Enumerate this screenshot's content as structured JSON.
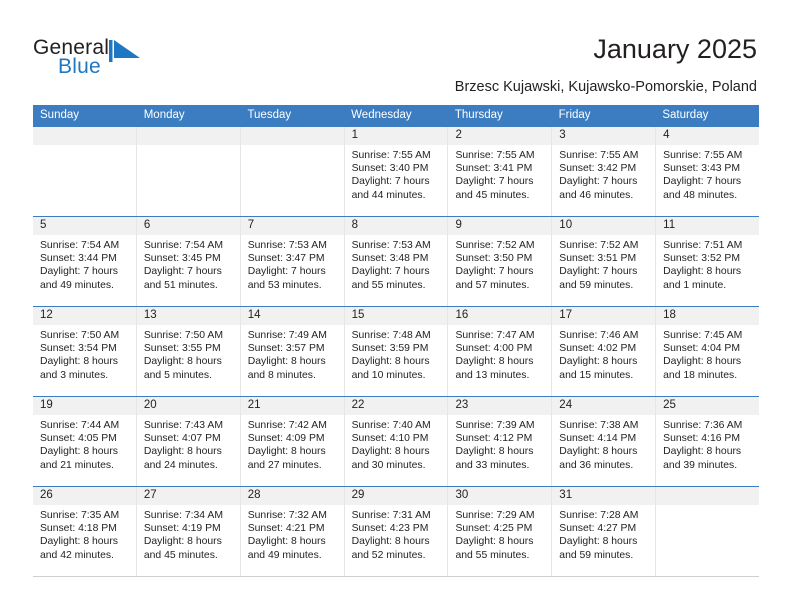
{
  "brand": {
    "name_part1": "General",
    "name_part2": "Blue",
    "accent_color": "#1f77c4",
    "logo_icon": "triangle-flag-icon"
  },
  "header": {
    "title": "January 2025",
    "location": "Brzesc Kujawski, Kujawsko-Pomorskie, Poland"
  },
  "calendar": {
    "header_bg": "#3b7dc0",
    "day_band_bg": "#f1f1f1",
    "weekdays": [
      "Sunday",
      "Monday",
      "Tuesday",
      "Wednesday",
      "Thursday",
      "Friday",
      "Saturday"
    ],
    "weeks": [
      [
        {
          "day": "",
          "sunrise": "",
          "sunset": "",
          "daylight_line1": "",
          "daylight_line2": ""
        },
        {
          "day": "",
          "sunrise": "",
          "sunset": "",
          "daylight_line1": "",
          "daylight_line2": ""
        },
        {
          "day": "",
          "sunrise": "",
          "sunset": "",
          "daylight_line1": "",
          "daylight_line2": ""
        },
        {
          "day": "1",
          "sunrise": "Sunrise: 7:55 AM",
          "sunset": "Sunset: 3:40 PM",
          "daylight_line1": "Daylight: 7 hours",
          "daylight_line2": "and 44 minutes."
        },
        {
          "day": "2",
          "sunrise": "Sunrise: 7:55 AM",
          "sunset": "Sunset: 3:41 PM",
          "daylight_line1": "Daylight: 7 hours",
          "daylight_line2": "and 45 minutes."
        },
        {
          "day": "3",
          "sunrise": "Sunrise: 7:55 AM",
          "sunset": "Sunset: 3:42 PM",
          "daylight_line1": "Daylight: 7 hours",
          "daylight_line2": "and 46 minutes."
        },
        {
          "day": "4",
          "sunrise": "Sunrise: 7:55 AM",
          "sunset": "Sunset: 3:43 PM",
          "daylight_line1": "Daylight: 7 hours",
          "daylight_line2": "and 48 minutes."
        }
      ],
      [
        {
          "day": "5",
          "sunrise": "Sunrise: 7:54 AM",
          "sunset": "Sunset: 3:44 PM",
          "daylight_line1": "Daylight: 7 hours",
          "daylight_line2": "and 49 minutes."
        },
        {
          "day": "6",
          "sunrise": "Sunrise: 7:54 AM",
          "sunset": "Sunset: 3:45 PM",
          "daylight_line1": "Daylight: 7 hours",
          "daylight_line2": "and 51 minutes."
        },
        {
          "day": "7",
          "sunrise": "Sunrise: 7:53 AM",
          "sunset": "Sunset: 3:47 PM",
          "daylight_line1": "Daylight: 7 hours",
          "daylight_line2": "and 53 minutes."
        },
        {
          "day": "8",
          "sunrise": "Sunrise: 7:53 AM",
          "sunset": "Sunset: 3:48 PM",
          "daylight_line1": "Daylight: 7 hours",
          "daylight_line2": "and 55 minutes."
        },
        {
          "day": "9",
          "sunrise": "Sunrise: 7:52 AM",
          "sunset": "Sunset: 3:50 PM",
          "daylight_line1": "Daylight: 7 hours",
          "daylight_line2": "and 57 minutes."
        },
        {
          "day": "10",
          "sunrise": "Sunrise: 7:52 AM",
          "sunset": "Sunset: 3:51 PM",
          "daylight_line1": "Daylight: 7 hours",
          "daylight_line2": "and 59 minutes."
        },
        {
          "day": "11",
          "sunrise": "Sunrise: 7:51 AM",
          "sunset": "Sunset: 3:52 PM",
          "daylight_line1": "Daylight: 8 hours",
          "daylight_line2": "and 1 minute."
        }
      ],
      [
        {
          "day": "12",
          "sunrise": "Sunrise: 7:50 AM",
          "sunset": "Sunset: 3:54 PM",
          "daylight_line1": "Daylight: 8 hours",
          "daylight_line2": "and 3 minutes."
        },
        {
          "day": "13",
          "sunrise": "Sunrise: 7:50 AM",
          "sunset": "Sunset: 3:55 PM",
          "daylight_line1": "Daylight: 8 hours",
          "daylight_line2": "and 5 minutes."
        },
        {
          "day": "14",
          "sunrise": "Sunrise: 7:49 AM",
          "sunset": "Sunset: 3:57 PM",
          "daylight_line1": "Daylight: 8 hours",
          "daylight_line2": "and 8 minutes."
        },
        {
          "day": "15",
          "sunrise": "Sunrise: 7:48 AM",
          "sunset": "Sunset: 3:59 PM",
          "daylight_line1": "Daylight: 8 hours",
          "daylight_line2": "and 10 minutes."
        },
        {
          "day": "16",
          "sunrise": "Sunrise: 7:47 AM",
          "sunset": "Sunset: 4:00 PM",
          "daylight_line1": "Daylight: 8 hours",
          "daylight_line2": "and 13 minutes."
        },
        {
          "day": "17",
          "sunrise": "Sunrise: 7:46 AM",
          "sunset": "Sunset: 4:02 PM",
          "daylight_line1": "Daylight: 8 hours",
          "daylight_line2": "and 15 minutes."
        },
        {
          "day": "18",
          "sunrise": "Sunrise: 7:45 AM",
          "sunset": "Sunset: 4:04 PM",
          "daylight_line1": "Daylight: 8 hours",
          "daylight_line2": "and 18 minutes."
        }
      ],
      [
        {
          "day": "19",
          "sunrise": "Sunrise: 7:44 AM",
          "sunset": "Sunset: 4:05 PM",
          "daylight_line1": "Daylight: 8 hours",
          "daylight_line2": "and 21 minutes."
        },
        {
          "day": "20",
          "sunrise": "Sunrise: 7:43 AM",
          "sunset": "Sunset: 4:07 PM",
          "daylight_line1": "Daylight: 8 hours",
          "daylight_line2": "and 24 minutes."
        },
        {
          "day": "21",
          "sunrise": "Sunrise: 7:42 AM",
          "sunset": "Sunset: 4:09 PM",
          "daylight_line1": "Daylight: 8 hours",
          "daylight_line2": "and 27 minutes."
        },
        {
          "day": "22",
          "sunrise": "Sunrise: 7:40 AM",
          "sunset": "Sunset: 4:10 PM",
          "daylight_line1": "Daylight: 8 hours",
          "daylight_line2": "and 30 minutes."
        },
        {
          "day": "23",
          "sunrise": "Sunrise: 7:39 AM",
          "sunset": "Sunset: 4:12 PM",
          "daylight_line1": "Daylight: 8 hours",
          "daylight_line2": "and 33 minutes."
        },
        {
          "day": "24",
          "sunrise": "Sunrise: 7:38 AM",
          "sunset": "Sunset: 4:14 PM",
          "daylight_line1": "Daylight: 8 hours",
          "daylight_line2": "and 36 minutes."
        },
        {
          "day": "25",
          "sunrise": "Sunrise: 7:36 AM",
          "sunset": "Sunset: 4:16 PM",
          "daylight_line1": "Daylight: 8 hours",
          "daylight_line2": "and 39 minutes."
        }
      ],
      [
        {
          "day": "26",
          "sunrise": "Sunrise: 7:35 AM",
          "sunset": "Sunset: 4:18 PM",
          "daylight_line1": "Daylight: 8 hours",
          "daylight_line2": "and 42 minutes."
        },
        {
          "day": "27",
          "sunrise": "Sunrise: 7:34 AM",
          "sunset": "Sunset: 4:19 PM",
          "daylight_line1": "Daylight: 8 hours",
          "daylight_line2": "and 45 minutes."
        },
        {
          "day": "28",
          "sunrise": "Sunrise: 7:32 AM",
          "sunset": "Sunset: 4:21 PM",
          "daylight_line1": "Daylight: 8 hours",
          "daylight_line2": "and 49 minutes."
        },
        {
          "day": "29",
          "sunrise": "Sunrise: 7:31 AM",
          "sunset": "Sunset: 4:23 PM",
          "daylight_line1": "Daylight: 8 hours",
          "daylight_line2": "and 52 minutes."
        },
        {
          "day": "30",
          "sunrise": "Sunrise: 7:29 AM",
          "sunset": "Sunset: 4:25 PM",
          "daylight_line1": "Daylight: 8 hours",
          "daylight_line2": "and 55 minutes."
        },
        {
          "day": "31",
          "sunrise": "Sunrise: 7:28 AM",
          "sunset": "Sunset: 4:27 PM",
          "daylight_line1": "Daylight: 8 hours",
          "daylight_line2": "and 59 minutes."
        },
        {
          "day": "",
          "sunrise": "",
          "sunset": "",
          "daylight_line1": "",
          "daylight_line2": ""
        }
      ]
    ]
  }
}
